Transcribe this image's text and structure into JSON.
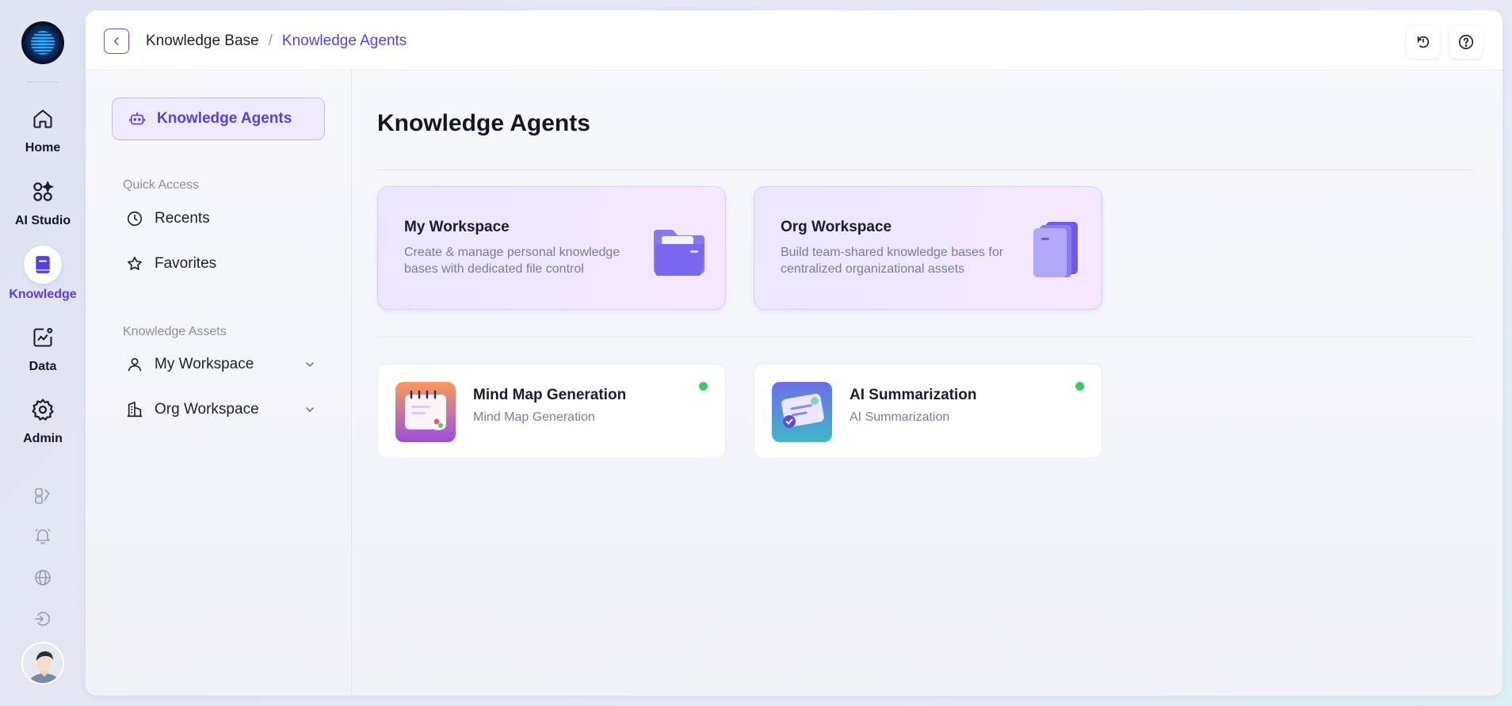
{
  "rail": {
    "items": [
      {
        "label": "Home",
        "icon": "home-icon"
      },
      {
        "label": "AI Studio",
        "icon": "ai-studio-icon"
      },
      {
        "label": "Knowledge",
        "icon": "book-icon"
      },
      {
        "label": "Data",
        "icon": "chart-icon"
      },
      {
        "label": "Admin",
        "icon": "gear-icon"
      }
    ],
    "active_index": 2,
    "utility_icons": [
      "shapes-icon",
      "bell-icon",
      "globe-icon",
      "logout-icon"
    ]
  },
  "breadcrumb": {
    "root": "Knowledge Base",
    "separator": "/",
    "current": "Knowledge Agents"
  },
  "topbar": {
    "icons": [
      "history-icon",
      "help-icon"
    ]
  },
  "subnav": {
    "active": "Knowledge Agents",
    "quick_access_label": "Quick Access",
    "quick_access": [
      {
        "label": "Recents",
        "icon": "clock-icon"
      },
      {
        "label": "Favorites",
        "icon": "star-icon"
      }
    ],
    "assets_label": "Knowledge Assets",
    "assets": [
      {
        "label": "My Workspace",
        "icon": "user-icon"
      },
      {
        "label": "Org Workspace",
        "icon": "building-icon"
      }
    ]
  },
  "main": {
    "title": "Knowledge Agents",
    "workspaces": [
      {
        "title": "My Workspace",
        "desc": "Create & manage personal knowledge bases with dedicated file control",
        "icon": "folder-icon"
      },
      {
        "title": "Org Workspace",
        "desc": "Build team-shared knowledge bases for centralized organizational assets",
        "icon": "binders-icon"
      }
    ],
    "agents": [
      {
        "name": "Mind Map Generation",
        "sub": "Mind Map Generation",
        "status": "online",
        "status_color": "#3cc769"
      },
      {
        "name": "AI Summarization",
        "sub": "AI Summarization",
        "status": "online",
        "status_color": "#3cc769"
      }
    ]
  },
  "colors": {
    "accent": "#5b3ee0",
    "active_bg": "#f0eaff"
  }
}
